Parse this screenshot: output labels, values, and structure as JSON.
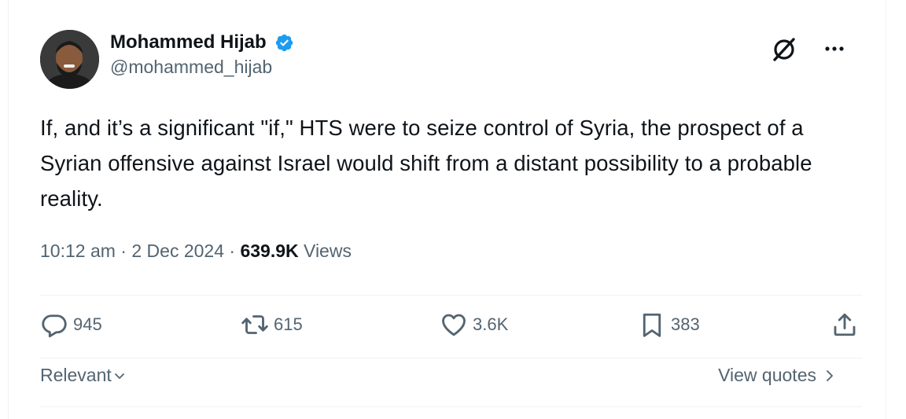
{
  "author": {
    "display_name": "Mohammed Hijab",
    "handle": "@mohammed_hijab"
  },
  "icons": {
    "verified": "verified-badge-icon",
    "grok": "grok-icon",
    "more": "more-options-icon",
    "reply": "reply-icon",
    "retweet": "retweet-icon",
    "like": "heart-icon",
    "bookmark": "bookmark-icon",
    "share": "share-icon"
  },
  "colors": {
    "verified_blue": "#1d9bf0",
    "text_primary": "#0f1419",
    "text_secondary": "#536471"
  },
  "tweet": {
    "text": "If, and it’s a significant \"if,\" HTS were to seize control of Syria, the prospect of a Syrian offensive against Israel would shift from a distant possibility to a probable reality.",
    "time": "10:12 am",
    "date": "2 Dec 2024",
    "separator": " · ",
    "views_count": "639.9K",
    "views_label": "Views"
  },
  "actions": {
    "replies": "945",
    "retweets": "615",
    "likes": "3.6K",
    "bookmarks": "383"
  },
  "footer": {
    "sort_label": "Relevant",
    "view_quotes_label": "View quotes"
  }
}
